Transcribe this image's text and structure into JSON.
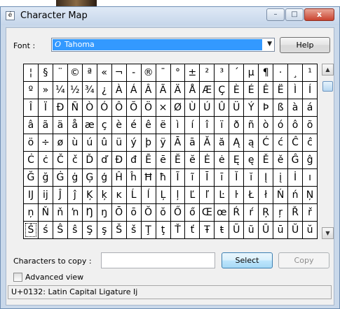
{
  "window": {
    "title": "Character Map",
    "app_icon_glyph": "é",
    "controls": {
      "minimize": "–",
      "maximize": "□",
      "close": "x"
    }
  },
  "font": {
    "label": "Font :",
    "selected": "Tahoma",
    "icon_glyph": "O",
    "dropdown_glyph": "▼"
  },
  "help_button": "Help",
  "grid": {
    "selected_index": 180,
    "characters": [
      "¦",
      "§",
      "¨",
      "©",
      "ª",
      "«",
      "¬",
      "-",
      "®",
      "¯",
      "°",
      "±",
      "²",
      "³",
      "´",
      "µ",
      "¶",
      "·",
      "¸",
      "¹",
      "º",
      "»",
      "¼",
      "½",
      "¾",
      "¿",
      "À",
      "Á",
      "Â",
      "Ã",
      "Ä",
      "Å",
      "Æ",
      "Ç",
      "È",
      "É",
      "Ê",
      "Ë",
      "Ì",
      "Í",
      "Î",
      "Ï",
      "Ð",
      "Ñ",
      "Ò",
      "Ó",
      "Ô",
      "Õ",
      "Ö",
      "×",
      "Ø",
      "Ù",
      "Ú",
      "Û",
      "Ü",
      "Ý",
      "Þ",
      "ß",
      "à",
      "á",
      "â",
      "ã",
      "ä",
      "å",
      "æ",
      "ç",
      "è",
      "é",
      "ê",
      "ë",
      "ì",
      "í",
      "î",
      "ï",
      "ð",
      "ñ",
      "ò",
      "ó",
      "ô",
      "õ",
      "ö",
      "÷",
      "ø",
      "ù",
      "ú",
      "û",
      "ü",
      "ý",
      "þ",
      "ÿ",
      "Ā",
      "ā",
      "Ă",
      "ă",
      "Ą",
      "ą",
      "Ć",
      "ć",
      "Ĉ",
      "ĉ",
      "Ċ",
      "ċ",
      "Č",
      "č",
      "Ď",
      "ď",
      "Đ",
      "đ",
      "Ē",
      "ē",
      "Ĕ",
      "ĕ",
      "Ė",
      "ė",
      "Ę",
      "ę",
      "Ě",
      "ě",
      "Ĝ",
      "ĝ",
      "Ğ",
      "ğ",
      "Ġ",
      "ġ",
      "Ģ",
      "ģ",
      "Ĥ",
      "ĥ",
      "Ħ",
      "ħ",
      "Ĩ",
      "ĩ",
      "Ī",
      "ī",
      "Ĭ",
      "ĭ",
      "Į",
      "į",
      "İ",
      "ı",
      "Ĳ",
      "ĳ",
      "Ĵ",
      "ĵ",
      "Ķ",
      "ķ",
      "ĸ",
      "Ĺ",
      "ĺ",
      "Ļ",
      "ļ",
      "Ľ",
      "ľ",
      "Ŀ",
      "ŀ",
      "Ł",
      "ł",
      "Ń",
      "ń",
      "Ņ",
      "ņ",
      "Ň",
      "ň",
      "ŉ",
      "Ŋ",
      "ŋ",
      "Ō",
      "ō",
      "Ŏ",
      "ŏ",
      "Ő",
      "ő",
      "Œ",
      "œ",
      "Ŕ",
      "ŕ",
      "Ŗ",
      "ŗ",
      "Ř",
      "ř",
      "Ś",
      "ś",
      "Ŝ",
      "ŝ",
      "Ş",
      "ş",
      "Š",
      "š",
      "Ţ",
      "ţ",
      "Ť",
      "ť",
      "Ŧ",
      "ŧ",
      "Ũ",
      "ũ",
      "Ū",
      "ū",
      "Ŭ",
      "ŭ"
    ]
  },
  "scrollbar": {
    "up_glyph": "▲",
    "down_glyph": "▼"
  },
  "copy": {
    "label": "Characters to copy :",
    "value": "",
    "select_button": "Select",
    "copy_button": "Copy"
  },
  "advanced_view": {
    "label": "Advanced view",
    "checked": false
  },
  "status": "U+0132: Latin Capital Ligature Ij"
}
